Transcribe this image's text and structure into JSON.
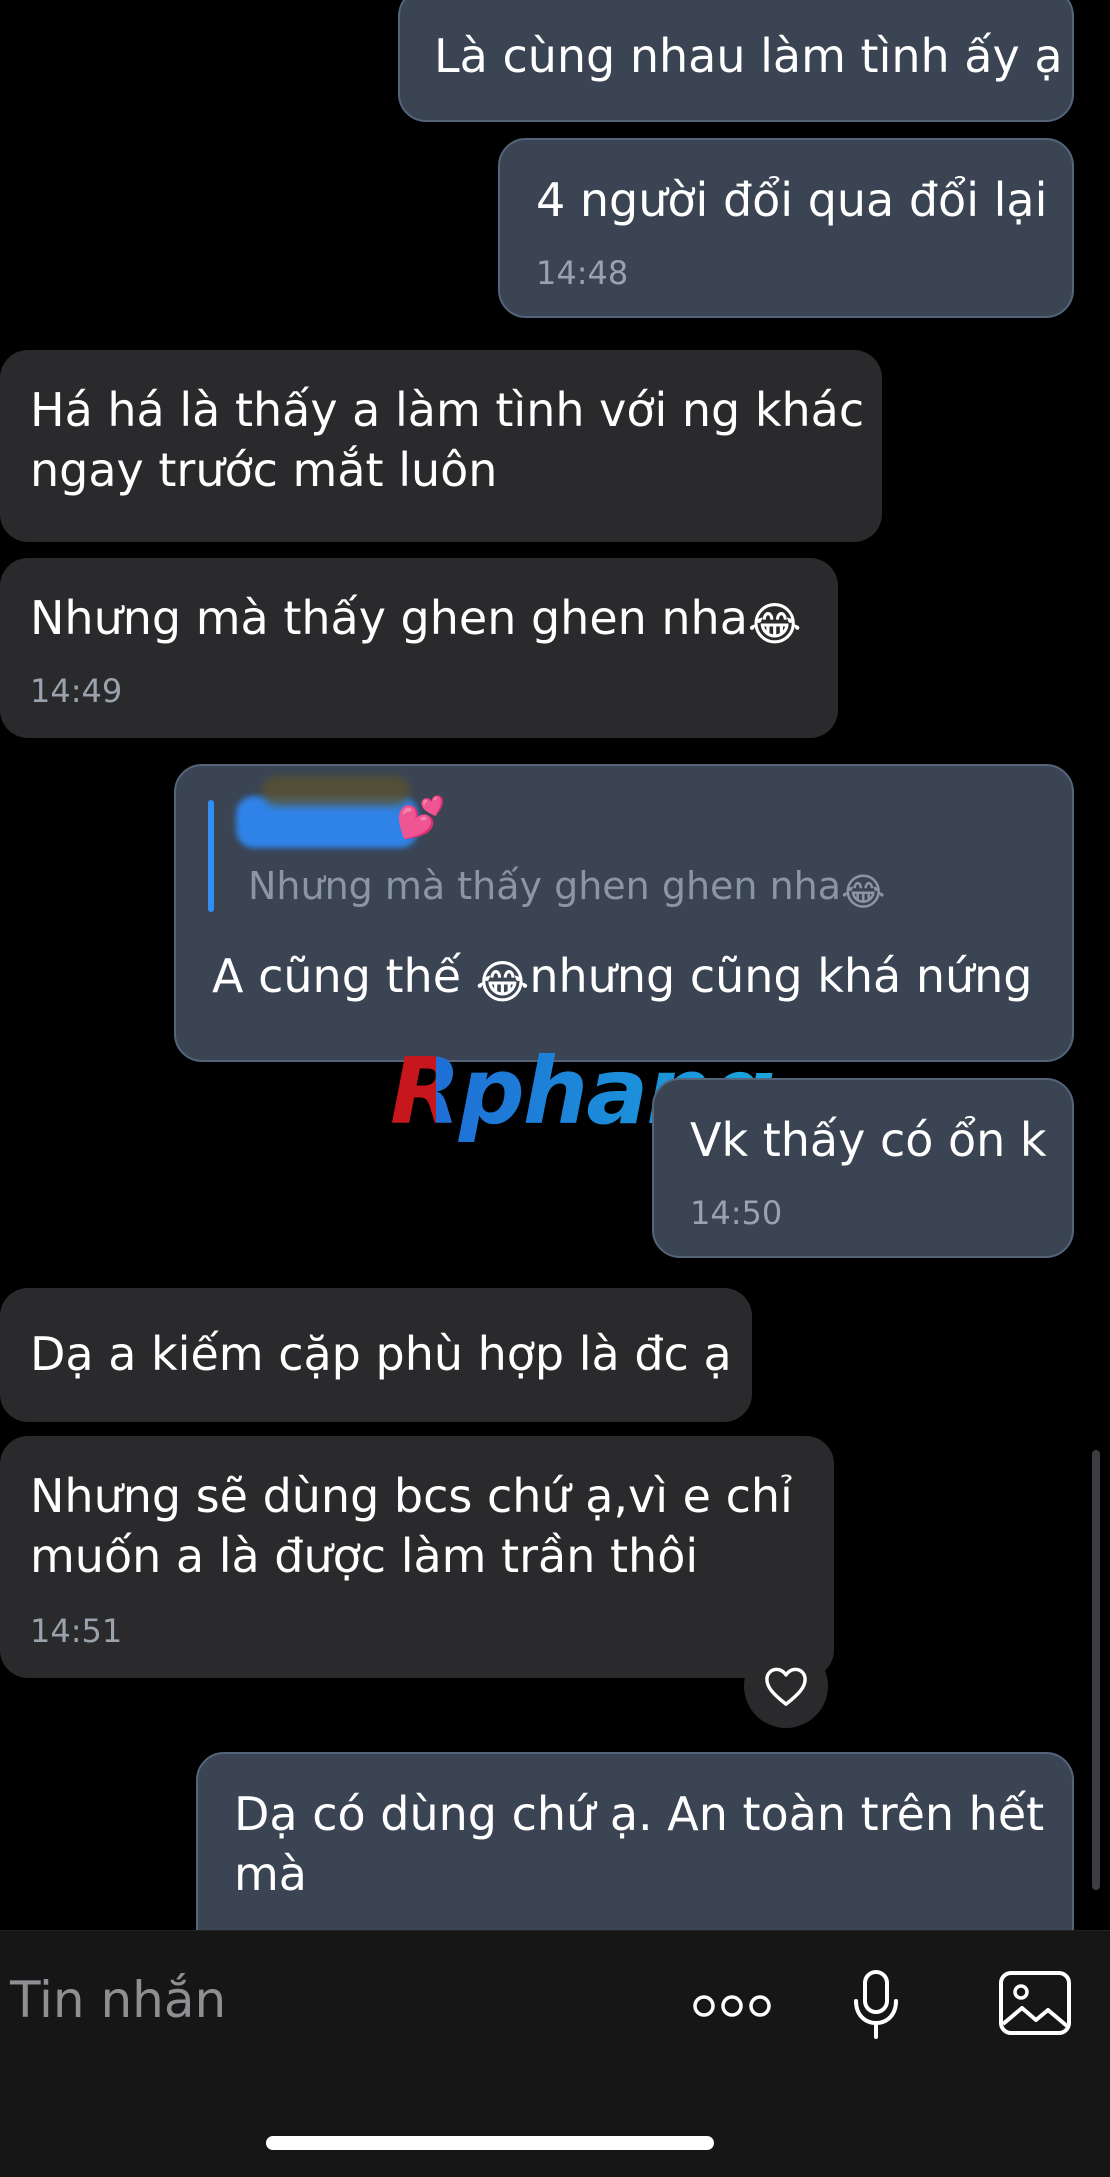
{
  "messages": [
    {
      "dir": "out",
      "text": "Là cùng nhau làm tình ấy ạ"
    },
    {
      "dir": "out",
      "text": "4 người đổi qua đổi lại",
      "time": "14:48"
    },
    {
      "dir": "in",
      "lines": [
        "Há há là thấy a làm tình với ng khác",
        "ngay trước mắt luôn"
      ]
    },
    {
      "dir": "in",
      "text": "Nhưng mà thấy ghen ghen nha",
      "time": "14:49"
    },
    {
      "dir": "out",
      "reply_to": {
        "sender_emoji": "💕",
        "text": "Nhưng mà thấy ghen ghen nha"
      },
      "text_before_emoji": "A cũng thế ",
      "text_after_emoji": "nhưng cũng khá nứng"
    },
    {
      "dir": "out",
      "text": "Vk thấy có ổn k",
      "time": "14:50"
    },
    {
      "dir": "in",
      "text": "Dạ a kiếm cặp phù hợp là đc ạ"
    },
    {
      "dir": "in",
      "lines": [
        "Nhưng sẽ dùng bcs chứ ạ,vì e chỉ",
        "muốn a là được làm trần thôi"
      ],
      "time": "14:51",
      "reaction": "heart-icon"
    },
    {
      "dir": "out",
      "lines": [
        "Dạ có dùng chứ ạ. An toàn trên hết",
        "mà"
      ]
    }
  ],
  "emoji": {
    "laugh": "😂"
  },
  "watermark": {
    "text": "Rphang"
  },
  "composer": {
    "placeholder": "Tin nhắn"
  },
  "icons": [
    "more-dots-icon",
    "microphone-icon",
    "gallery-icon",
    "heart-icon"
  ],
  "colors": {
    "outgoing_bubble": "#3a4453",
    "incoming_bubble": "#2a2a2c",
    "quote_bar": "#2f8ff3",
    "background": "#000000"
  }
}
